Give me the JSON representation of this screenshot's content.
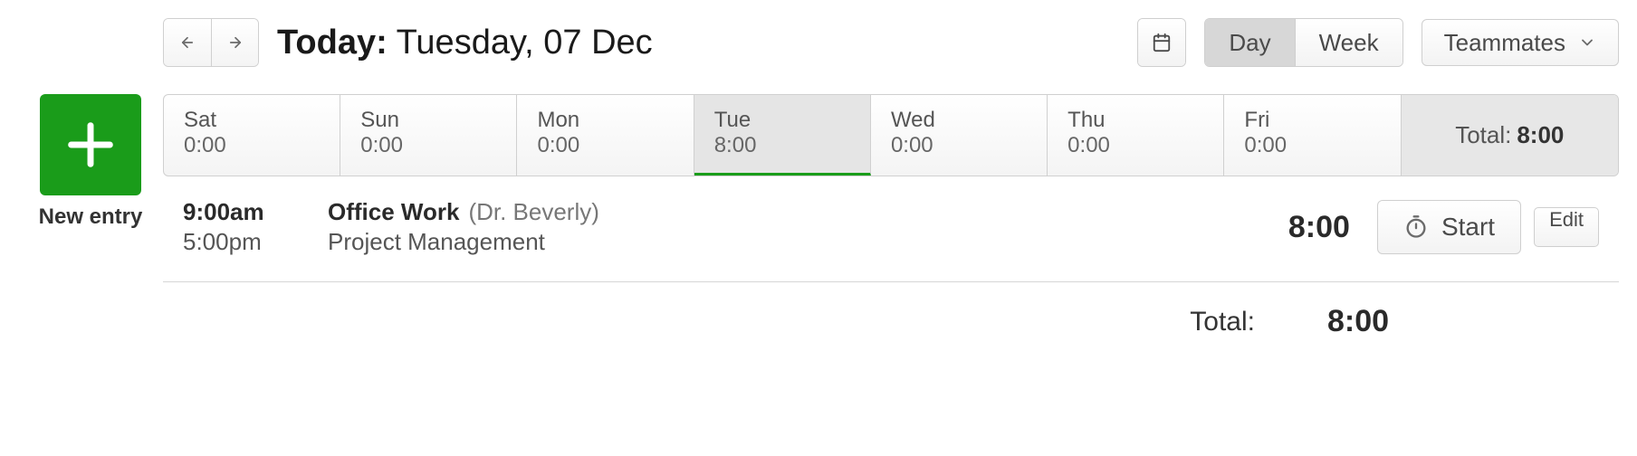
{
  "header": {
    "today_label": "Today:",
    "today_date": "Tuesday, 07 Dec",
    "view_day": "Day",
    "view_week": "Week",
    "teammates": "Teammates"
  },
  "new_entry": {
    "label": "New entry"
  },
  "days": [
    {
      "name": "Sat",
      "hours": "0:00",
      "selected": false
    },
    {
      "name": "Sun",
      "hours": "0:00",
      "selected": false
    },
    {
      "name": "Mon",
      "hours": "0:00",
      "selected": false
    },
    {
      "name": "Tue",
      "hours": "8:00",
      "selected": true
    },
    {
      "name": "Wed",
      "hours": "0:00",
      "selected": false
    },
    {
      "name": "Thu",
      "hours": "0:00",
      "selected": false
    },
    {
      "name": "Fri",
      "hours": "0:00",
      "selected": false
    }
  ],
  "strip_total": {
    "label": "Total:",
    "value": "8:00"
  },
  "entry": {
    "start_time": "9:00am",
    "end_time": "5:00pm",
    "task": "Office Work",
    "client": "(Dr. Beverly)",
    "project": "Project Management",
    "duration": "8:00",
    "start_label": "Start",
    "edit_label": "Edit"
  },
  "footer": {
    "label": "Total:",
    "value": "8:00"
  }
}
